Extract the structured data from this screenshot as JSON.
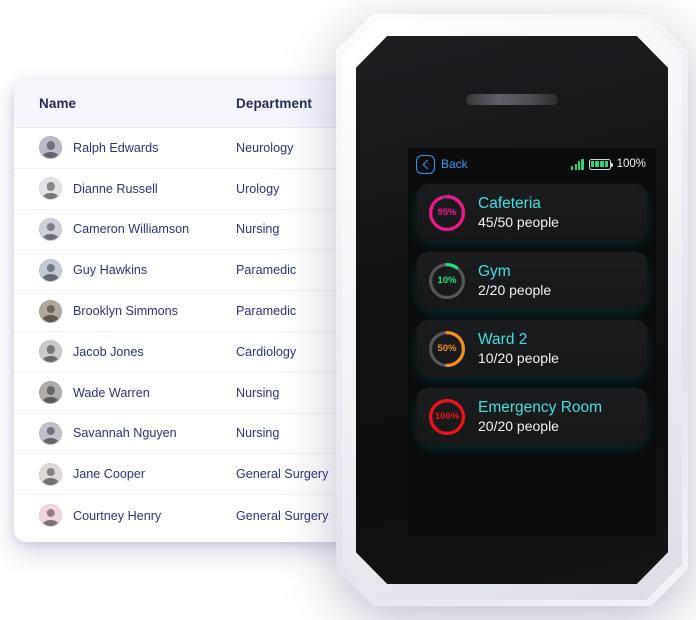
{
  "staff_panel": {
    "columns": [
      "Name",
      "Department"
    ],
    "rows": [
      {
        "name": "Ralph Edwards",
        "department": "Neurology",
        "avatar_tone": "#b9bcc6"
      },
      {
        "name": "Dianne Russell",
        "department": "Urology",
        "avatar_tone": "#e2e3e7"
      },
      {
        "name": "Cameron Williamson",
        "department": "Nursing",
        "avatar_tone": "#cdd2da"
      },
      {
        "name": "Guy Hawkins",
        "department": "Paramedic",
        "avatar_tone": "#c3cad6"
      },
      {
        "name": "Brooklyn Simmons",
        "department": "Paramedic",
        "avatar_tone": "#b2a79b"
      },
      {
        "name": "Jacob Jones",
        "department": "Cardiology",
        "avatar_tone": "#c8c9cc"
      },
      {
        "name": "Wade Warren",
        "department": "Nursing",
        "avatar_tone": "#b0aca8"
      },
      {
        "name": "Savannah Nguyen",
        "department": "Nursing",
        "avatar_tone": "#bfc2ca"
      },
      {
        "name": "Jane Cooper",
        "department": "General Surgery",
        "avatar_tone": "#ded9d4"
      },
      {
        "name": "Courtney Henry",
        "department": "General Surgery",
        "avatar_tone": "#f2d6de"
      }
    ]
  },
  "device": {
    "status_bar": {
      "back_label": "Back",
      "back_icon": "chevron-left-icon",
      "signal_icon": "signal-bars-icon",
      "battery_icon": "battery-full-icon",
      "battery_percent": "100%"
    },
    "rooms": [
      {
        "name": "Cafeteria",
        "occupancy": "45/50 people",
        "percent_label": "95%",
        "percent": 95,
        "color": "#f0168c"
      },
      {
        "name": "Gym",
        "occupancy": "2/20 people",
        "percent_label": "10%",
        "percent": 10,
        "color": "#14e87f"
      },
      {
        "name": "Ward 2",
        "occupancy": "10/20 people",
        "percent_label": "50%",
        "percent": 50,
        "color": "#f2901a"
      },
      {
        "name": "Emergency Room",
        "occupancy": "20/20 people",
        "percent_label": "100%",
        "percent": 100,
        "color": "#f50f14"
      }
    ]
  },
  "colors": {
    "panel_header_bg": "#f5f7fd",
    "panel_text": "#2b3478",
    "screen_bg": "#0a0b0d",
    "card_bg": "#1b1c1f",
    "card_title": "#3fe0e0",
    "accent_blue": "#2f9bf5",
    "status_green": "#2fd37a"
  }
}
